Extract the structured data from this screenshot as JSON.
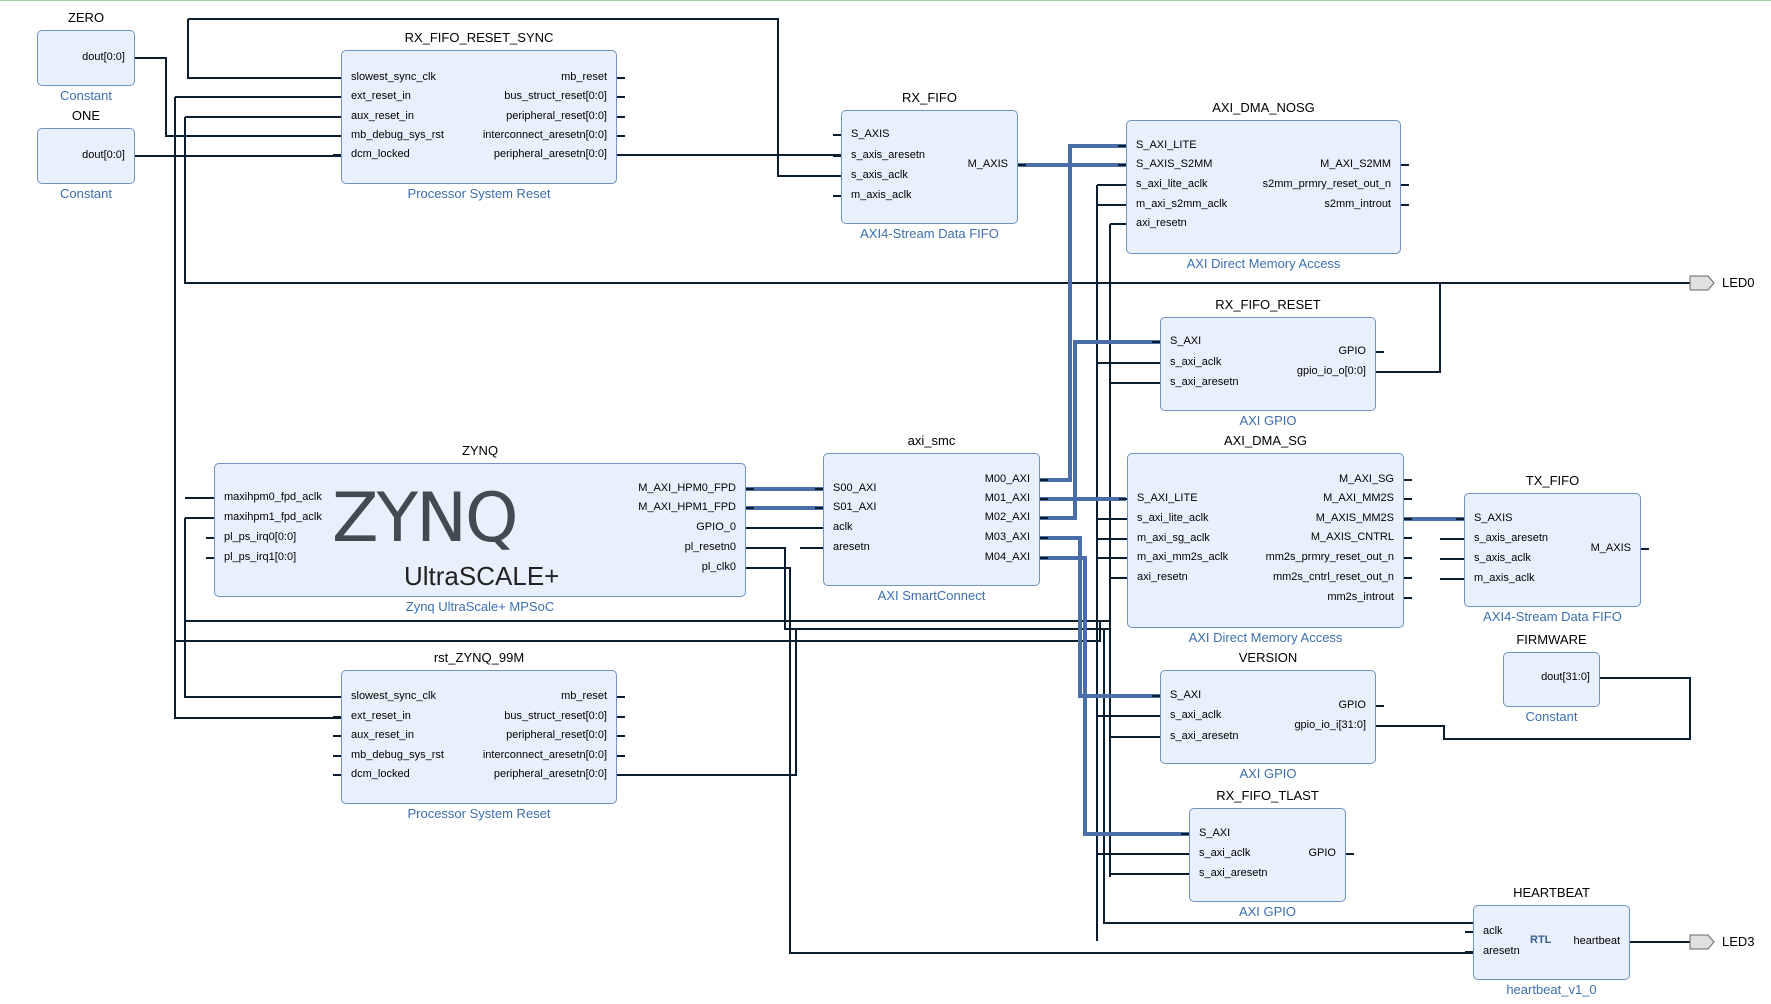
{
  "blocks": [
    {
      "id": "zero",
      "instance": "ZERO",
      "ip": "Constant",
      "ports_left": [],
      "ports_right": [
        "dout[0:0]"
      ]
    },
    {
      "id": "one",
      "instance": "ONE",
      "ip": "Constant",
      "ports_left": [],
      "ports_right": [
        "dout[0:0]"
      ]
    },
    {
      "id": "rx_fifo_reset_sync",
      "instance": "RX_FIFO_RESET_SYNC",
      "ip": "Processor System Reset",
      "ports_left": [
        "slowest_sync_clk",
        "ext_reset_in",
        "aux_reset_in",
        "mb_debug_sys_rst",
        "dcm_locked"
      ],
      "ports_right": [
        "mb_reset",
        "bus_struct_reset[0:0]",
        "peripheral_reset[0:0]",
        "interconnect_aresetn[0:0]",
        "peripheral_aresetn[0:0]"
      ]
    },
    {
      "id": "rx_fifo",
      "instance": "RX_FIFO",
      "ip": "AXI4-Stream Data FIFO",
      "ports_left": [
        "S_AXIS",
        "s_axis_aresetn",
        "s_axis_aclk",
        "m_axis_aclk"
      ],
      "ports_right": [
        "M_AXIS"
      ]
    },
    {
      "id": "axi_dma_nosg",
      "instance": "AXI_DMA_NOSG",
      "ip": "AXI Direct Memory Access",
      "ports_left": [
        "S_AXI_LITE",
        "S_AXIS_S2MM",
        "s_axi_lite_aclk",
        "m_axi_s2mm_aclk",
        "axi_resetn"
      ],
      "ports_right": [
        "M_AXI_S2MM",
        "s2mm_prmry_reset_out_n",
        "s2mm_introut"
      ]
    },
    {
      "id": "rx_fifo_reset",
      "instance": "RX_FIFO_RESET",
      "ip": "AXI GPIO",
      "ports_left": [
        "S_AXI",
        "s_axi_aclk",
        "s_axi_aresetn"
      ],
      "ports_right": [
        "GPIO",
        "gpio_io_o[0:0]"
      ]
    },
    {
      "id": "zynq",
      "instance": "ZYNQ",
      "ip": "Zynq UltraScale+ MPSoC",
      "ports_left": [
        "maxihpm0_fpd_aclk",
        "maxihpm1_fpd_aclk",
        "pl_ps_irq0[0:0]",
        "pl_ps_irq1[0:0]"
      ],
      "ports_right": [
        "M_AXI_HPM0_FPD",
        "M_AXI_HPM1_FPD",
        "GPIO_0",
        "pl_resetn0",
        "pl_clk0"
      ]
    },
    {
      "id": "axi_smc",
      "instance": "axi_smc",
      "ip": "AXI SmartConnect",
      "ports_left": [
        "S00_AXI",
        "S01_AXI",
        "aclk",
        "aresetn"
      ],
      "ports_right": [
        "M00_AXI",
        "M01_AXI",
        "M02_AXI",
        "M03_AXI",
        "M04_AXI"
      ]
    },
    {
      "id": "axi_dma_sg",
      "instance": "AXI_DMA_SG",
      "ip": "AXI Direct Memory Access",
      "ports_left": [
        "S_AXI_LITE",
        "s_axi_lite_aclk",
        "m_axi_sg_aclk",
        "m_axi_mm2s_aclk",
        "axi_resetn"
      ],
      "ports_right": [
        "M_AXI_SG",
        "M_AXI_MM2S",
        "M_AXIS_MM2S",
        "M_AXIS_CNTRL",
        "mm2s_prmry_reset_out_n",
        "mm2s_cntrl_reset_out_n",
        "mm2s_introut"
      ]
    },
    {
      "id": "tx_fifo",
      "instance": "TX_FIFO",
      "ip": "AXI4-Stream Data FIFO",
      "ports_left": [
        "S_AXIS",
        "s_axis_aresetn",
        "s_axis_aclk",
        "m_axis_aclk"
      ],
      "ports_right": [
        "M_AXIS"
      ]
    },
    {
      "id": "rst_zynq",
      "instance": "rst_ZYNQ_99M",
      "ip": "Processor System Reset",
      "ports_left": [
        "slowest_sync_clk",
        "ext_reset_in",
        "aux_reset_in",
        "mb_debug_sys_rst",
        "dcm_locked"
      ],
      "ports_right": [
        "mb_reset",
        "bus_struct_reset[0:0]",
        "peripheral_reset[0:0]",
        "interconnect_aresetn[0:0]",
        "peripheral_aresetn[0:0]"
      ]
    },
    {
      "id": "version",
      "instance": "VERSION",
      "ip": "AXI GPIO",
      "ports_left": [
        "S_AXI",
        "s_axi_aclk",
        "s_axi_aresetn"
      ],
      "ports_right": [
        "GPIO",
        "gpio_io_i[31:0]"
      ]
    },
    {
      "id": "firmware",
      "instance": "FIRMWARE",
      "ip": "Constant",
      "ports_left": [],
      "ports_right": [
        "dout[31:0]"
      ]
    },
    {
      "id": "rx_fifo_tlast",
      "instance": "RX_FIFO_TLAST",
      "ip": "AXI GPIO",
      "ports_left": [
        "S_AXI",
        "s_axi_aclk",
        "s_axi_aresetn"
      ],
      "ports_right": [
        "GPIO"
      ]
    },
    {
      "id": "heartbeat",
      "instance": "HEARTBEAT",
      "ip": "heartbeat_v1_0",
      "ports_left": [
        "aclk",
        "aresetn"
      ],
      "ports_right": [
        "heartbeat"
      ]
    }
  ],
  "external_ports": [
    "LED0",
    "LED3"
  ],
  "logo": {
    "zynq_text": "ZYNQ",
    "ultrascale_text": "UltraSCALE+",
    "rtl_badge": "RTL"
  },
  "colors": {
    "block_fill": "#e8f1fb",
    "block_border": "#6f93c2",
    "wire": "#0a1e30",
    "bus": "#4a6ea8",
    "ip_label": "#3a6fb0"
  }
}
